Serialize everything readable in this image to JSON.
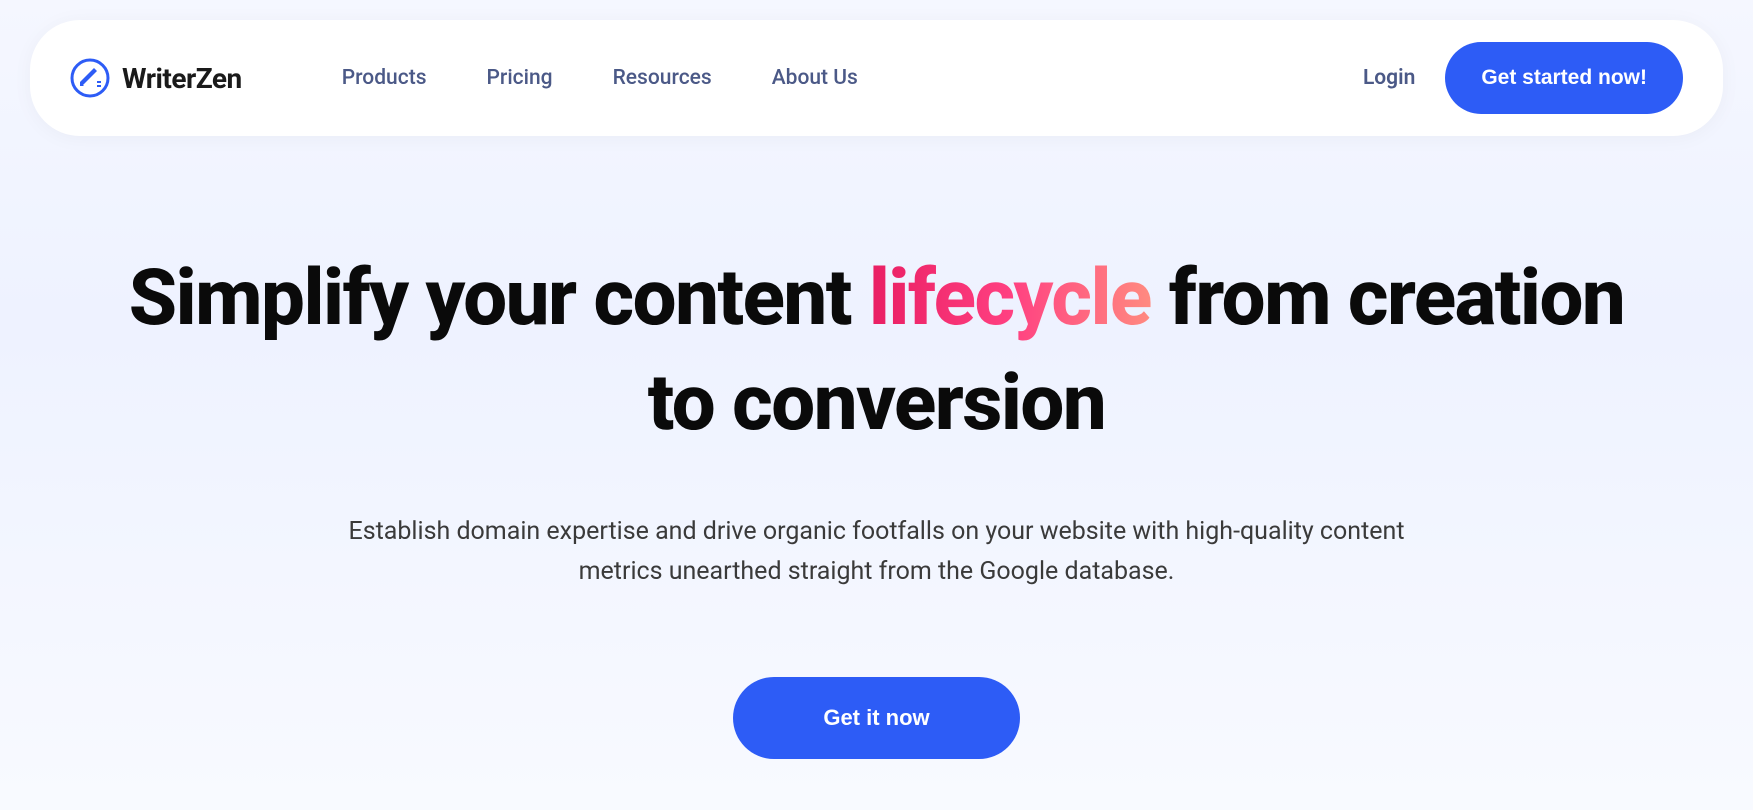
{
  "brand": {
    "name": "WriterZen"
  },
  "nav": {
    "links": [
      {
        "label": "Products"
      },
      {
        "label": "Pricing"
      },
      {
        "label": "Resources"
      },
      {
        "label": "About Us"
      }
    ],
    "login": "Login",
    "cta": "Get started now!"
  },
  "hero": {
    "title_part1": "Simplify your content ",
    "title_highlight": "lifecycle",
    "title_part2": " from creation to conversion",
    "subtitle": "Establish domain expertise and drive organic footfalls on your website with high-quality content metrics unearthed straight from the Google database.",
    "cta": "Get it now"
  }
}
